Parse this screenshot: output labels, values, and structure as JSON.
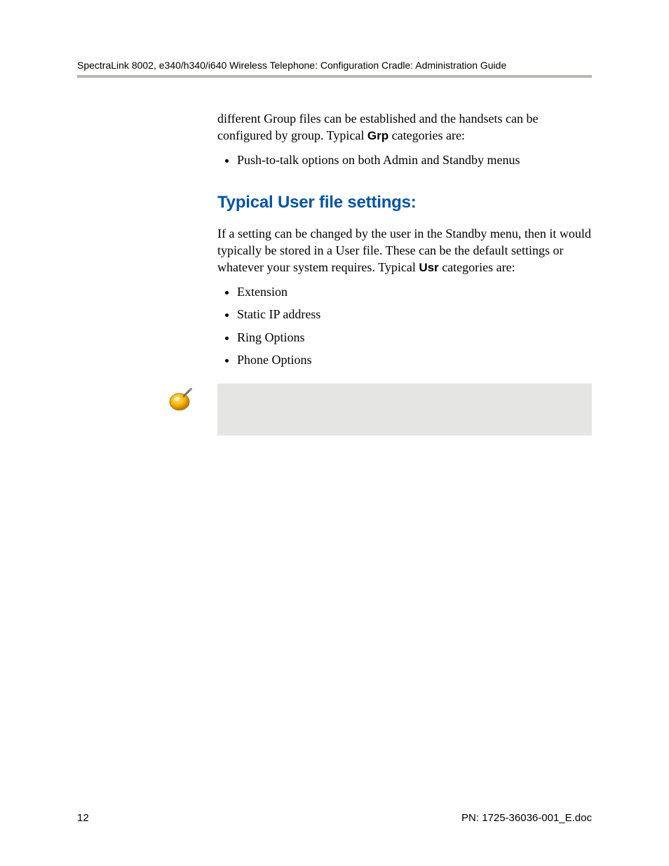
{
  "header": {
    "running_title": "SpectraLink 8002, e340/h340/i640 Wireless Telephone: Configuration Cradle: Administration Guide"
  },
  "body": {
    "lead_para_parts": {
      "before_bold": "different Group files can be established and the handsets can be configured by group. Typical ",
      "bold": "Grp",
      "after_bold": " categories are:"
    },
    "grp_list": [
      "Push-to-talk options on both Admin and Standby menus"
    ],
    "section_heading": "Typical User file settings:",
    "usr_para_parts": {
      "before_bold": "If a setting can be changed by the user in the Standby menu, then it would typically be stored in a User file. These can be the default settings or whatever your system requires. Typical ",
      "bold": "Usr",
      "after_bold": " categories are:"
    },
    "usr_list": [
      "Extension",
      "Static IP address",
      "Ring Options",
      "Phone Options"
    ]
  },
  "footer": {
    "page_number": "12",
    "doc_id": "PN: 1725-36036-001_E.doc"
  }
}
